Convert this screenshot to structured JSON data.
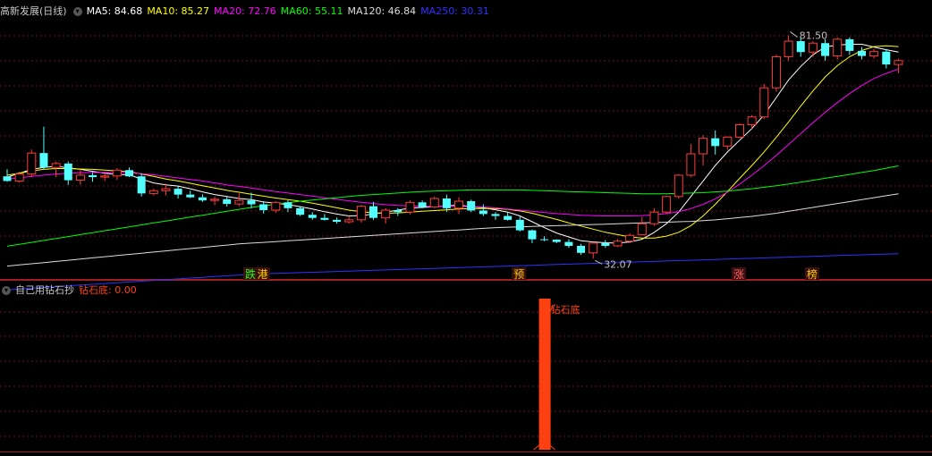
{
  "main_panel": {
    "title": "高新发展(日线)",
    "ma": [
      {
        "label": "MA5: 84.68",
        "color": "#ffffff"
      },
      {
        "label": "MA10: 85.27",
        "color": "#ffff00"
      },
      {
        "label": "MA20: 72.76",
        "color": "#ff00ff"
      },
      {
        "label": "MA60: 55.11",
        "color": "#00ff00"
      },
      {
        "label": "MA120: 46.84",
        "color": "#dcdcdc"
      },
      {
        "label": "MA250: 30.31",
        "color": "#3030ff"
      }
    ],
    "high_label": "81.50",
    "low_label": "32.07",
    "signals": [
      {
        "text": "跌",
        "color": "#20ff20",
        "bg": "#3a1010",
        "x_index": 20
      },
      {
        "text": "港",
        "color": "#ffcc00",
        "bg": "#3a1010",
        "x_index": 21
      },
      {
        "text": "预",
        "color": "#ffcc00",
        "bg": "#3a1010",
        "x_index": 42
      },
      {
        "text": "涨",
        "color": "#ff6060",
        "bg": "#3a1010",
        "x_index": 60
      },
      {
        "text": "榜",
        "color": "#ffcc00",
        "bg": "#3a1010",
        "x_index": 66
      }
    ]
  },
  "sub_panel": {
    "title": "自己用钻石抄",
    "value_label": "钻石底: 0.00",
    "annotation": "钻石底"
  },
  "colors": {
    "up": "#ff3c3c",
    "down": "#54ffff",
    "grid": "#6b1414",
    "bar": "#ff4010"
  },
  "chart_data": {
    "type": "candlestick",
    "ylim": [
      22,
      86
    ],
    "candles": [
      [
        45.2,
        47.0,
        43.8,
        44.0
      ],
      [
        44.0,
        46.4,
        43.6,
        45.8
      ],
      [
        45.8,
        52.1,
        45.0,
        51.2
      ],
      [
        51.2,
        58.0,
        47.0,
        47.5
      ],
      [
        47.5,
        49.0,
        45.0,
        48.5
      ],
      [
        48.5,
        49.0,
        43.0,
        44.2
      ],
      [
        44.2,
        47.0,
        43.0,
        45.5
      ],
      [
        45.5,
        46.3,
        43.8,
        45.0
      ],
      [
        45.0,
        46.0,
        44.0,
        45.3
      ],
      [
        45.3,
        47.3,
        44.3,
        46.8
      ],
      [
        46.8,
        47.5,
        45.0,
        45.2
      ],
      [
        45.2,
        46.0,
        40.0,
        40.8
      ],
      [
        40.8,
        42.0,
        40.3,
        41.5
      ],
      [
        41.5,
        43.3,
        40.3,
        42.0
      ],
      [
        42.0,
        42.6,
        39.5,
        40.5
      ],
      [
        40.5,
        41.5,
        39.6,
        39.8
      ],
      [
        39.8,
        40.6,
        38.6,
        39.0
      ],
      [
        39.0,
        40.0,
        37.8,
        39.3
      ],
      [
        39.3,
        40.0,
        37.4,
        38.1
      ],
      [
        38.1,
        40.8,
        37.5,
        39.0
      ],
      [
        39.0,
        41.0,
        37.0,
        38.0
      ],
      [
        38.0,
        38.8,
        35.6,
        36.5
      ],
      [
        36.5,
        38.8,
        35.8,
        38.5
      ],
      [
        38.5,
        39.0,
        36.0,
        37.0
      ],
      [
        37.0,
        37.4,
        35.0,
        35.3
      ],
      [
        35.3,
        36.0,
        34.0,
        34.5
      ],
      [
        34.5,
        35.5,
        33.8,
        34.0
      ],
      [
        34.0,
        34.6,
        33.0,
        33.5
      ],
      [
        33.5,
        35.0,
        33.0,
        34.0
      ],
      [
        34.0,
        37.8,
        33.3,
        37.5
      ],
      [
        37.5,
        38.6,
        34.0,
        34.5
      ],
      [
        34.5,
        37.0,
        33.0,
        36.5
      ],
      [
        36.5,
        37.0,
        35.0,
        36.0
      ],
      [
        36.0,
        39.0,
        35.4,
        38.5
      ],
      [
        38.5,
        39.0,
        37.0,
        37.3
      ],
      [
        37.3,
        40.0,
        37.0,
        39.5
      ],
      [
        39.5,
        40.5,
        36.0,
        37.0
      ],
      [
        37.0,
        39.8,
        35.5,
        38.8
      ],
      [
        38.8,
        39.2,
        36.0,
        36.4
      ],
      [
        36.4,
        38.0,
        35.0,
        35.5
      ],
      [
        35.5,
        36.0,
        34.0,
        35.0
      ],
      [
        35.0,
        36.0,
        33.8,
        34.0
      ],
      [
        34.0,
        34.8,
        31.0,
        31.3
      ],
      [
        31.3,
        31.5,
        28.0,
        29.0
      ],
      [
        29.0,
        29.8,
        28.5,
        28.9
      ],
      [
        28.9,
        29.0,
        28.0,
        28.3
      ],
      [
        28.3,
        29.0,
        26.8,
        27.3
      ],
      [
        27.3,
        27.8,
        25.0,
        25.5
      ],
      [
        25.5,
        28.2,
        24.0,
        28.0
      ],
      [
        28.0,
        28.8,
        26.8,
        27.3
      ],
      [
        27.3,
        29.0,
        27.0,
        28.5
      ],
      [
        28.5,
        30.5,
        28.0,
        30.0
      ],
      [
        30.2,
        34.7,
        30.0,
        33.0
      ],
      [
        33.0,
        37.0,
        32.5,
        36.0
      ],
      [
        36.0,
        40.2,
        35.5,
        40.0
      ],
      [
        40.0,
        45.7,
        39.5,
        45.5
      ],
      [
        45.5,
        53.5,
        45.0,
        51.0
      ],
      [
        51.0,
        55.8,
        48.0,
        55.0
      ],
      [
        55.0,
        57.0,
        50.8,
        53.0
      ],
      [
        53.0,
        55.5,
        52.0,
        55.3
      ],
      [
        55.3,
        58.8,
        55.0,
        58.5
      ],
      [
        58.5,
        61.0,
        57.5,
        60.5
      ],
      [
        60.5,
        69.0,
        60.0,
        68.0
      ],
      [
        68.0,
        76.5,
        67.0,
        76.0
      ],
      [
        76.0,
        81.5,
        75.0,
        80.0
      ],
      [
        80.0,
        81.0,
        76.0,
        77.2
      ],
      [
        77.2,
        80.0,
        76.0,
        79.5
      ],
      [
        79.5,
        80.5,
        75.0,
        76.2
      ],
      [
        76.2,
        81.0,
        75.3,
        80.5
      ],
      [
        80.5,
        81.0,
        76.5,
        77.5
      ],
      [
        77.5,
        78.5,
        75.3,
        76.2
      ],
      [
        76.2,
        78.0,
        75.5,
        77.3
      ],
      [
        77.3,
        78.0,
        73.0,
        74.0
      ],
      [
        74.0,
        75.5,
        71.8,
        75.0
      ]
    ],
    "ma_series": [
      {
        "name": "MA5",
        "color": "#ffffff",
        "values": [
          45,
          46,
          47,
          47.5,
          47.8,
          47.4,
          47,
          46.5,
          46,
          45.7,
          45.6,
          44.5,
          43.5,
          43,
          42.7,
          42,
          41.2,
          40.5,
          40,
          39.5,
          39.2,
          38.6,
          38.3,
          37.9,
          37.4,
          36.8,
          36.1,
          35.5,
          35,
          35.1,
          35.5,
          36,
          36.5,
          37,
          37.2,
          37.4,
          37.6,
          37.8,
          37.4,
          37.1,
          36.6,
          36,
          35,
          33.5,
          32,
          30.6,
          29.6,
          28.6,
          28.3,
          28.1,
          28,
          28.3,
          29,
          30.8,
          33,
          36,
          40,
          44,
          48,
          51.5,
          54.5,
          57.5,
          61,
          65.5,
          70,
          73.5,
          76.5,
          78.5,
          79,
          79.2,
          79.2,
          78.5,
          77.8,
          77.2
        ]
      },
      {
        "name": "MA10",
        "color": "#ffff00",
        "values": [
          45.5,
          46,
          46.6,
          47,
          47.2,
          47.2,
          47.1,
          47,
          46.8,
          46.6,
          46.4,
          45.8,
          45.2,
          44.5,
          44,
          43.4,
          42.8,
          42.2,
          41.6,
          41.1,
          40.6,
          40.1,
          39.6,
          39.2,
          38.8,
          38.3,
          37.7,
          37.1,
          36.5,
          36.1,
          35.8,
          35.7,
          35.8,
          36,
          36.2,
          36.4,
          36.6,
          36.8,
          36.9,
          36.9,
          36.9,
          36.7,
          36.3,
          35.7,
          34.9,
          34.1,
          33.2,
          32.4,
          31.6,
          30.8,
          30.2,
          29.6,
          29.3,
          29.3,
          29.8,
          30.8,
          32.5,
          35,
          38,
          41.3,
          44.7,
          48,
          51.5,
          55.3,
          59.2,
          63.3,
          67.2,
          70.8,
          73.7,
          76,
          77.6,
          78.6,
          78.8,
          78.6
        ]
      },
      {
        "name": "MA20",
        "color": "#ff00ff",
        "values": [
          44.5,
          44.8,
          45.2,
          45.5,
          45.8,
          46,
          46.1,
          46.2,
          46.2,
          46.2,
          46.1,
          45.9,
          45.6,
          45.2,
          44.8,
          44.4,
          44,
          43.5,
          43,
          42.6,
          42.2,
          41.7,
          41.3,
          40.9,
          40.5,
          40.1,
          39.7,
          39.3,
          38.9,
          38.5,
          38.2,
          37.9,
          37.7,
          37.6,
          37.5,
          37.5,
          37.5,
          37.5,
          37.4,
          37.3,
          37.1,
          36.8,
          36.5,
          36.2,
          35.9,
          35.6,
          35.4,
          35.2,
          35.1,
          35,
          35,
          35,
          35.1,
          35.3,
          35.6,
          36.1,
          36.9,
          38,
          39.4,
          41.1,
          43.2,
          45.5,
          48,
          50.6,
          53.4,
          56.2,
          59,
          61.7,
          64.2,
          66.5,
          68.6,
          70.4,
          71.7,
          72.8
        ]
      },
      {
        "name": "MA60",
        "color": "#00ff00",
        "values": [
          27.2,
          27.7,
          28.2,
          28.7,
          29.2,
          29.7,
          30.2,
          30.7,
          31.2,
          31.7,
          32.2,
          32.7,
          33.2,
          33.7,
          34.2,
          34.7,
          35.2,
          35.7,
          36.2,
          36.7,
          37.2,
          37.6,
          38,
          38.4,
          38.8,
          39.1,
          39.4,
          39.7,
          40,
          40.3,
          40.5,
          40.7,
          40.9,
          41.1,
          41.3,
          41.4,
          41.5,
          41.6,
          41.7,
          41.7,
          41.7,
          41.7,
          41.7,
          41.6,
          41.5,
          41.4,
          41.3,
          41.2,
          41.1,
          41,
          40.9,
          40.8,
          40.7,
          40.7,
          40.7,
          40.8,
          40.9,
          41,
          41.2,
          41.4,
          41.7,
          42,
          42.4,
          42.8,
          43.2,
          43.7,
          44.2,
          44.7,
          45.2,
          45.7,
          46.2,
          46.7,
          47.3,
          47.9
        ]
      },
      {
        "name": "MA120",
        "color": "#dcdcdc",
        "values": [
          22.1,
          22.4,
          22.7,
          23,
          23.3,
          23.6,
          23.9,
          24.2,
          24.5,
          24.8,
          25.1,
          25.4,
          25.7,
          26,
          26.3,
          26.6,
          26.9,
          27.2,
          27.5,
          27.8,
          28,
          28.2,
          28.4,
          28.6,
          28.8,
          29,
          29.2,
          29.4,
          29.6,
          29.8,
          30,
          30.2,
          30.4,
          30.6,
          30.8,
          31,
          31.2,
          31.4,
          31.6,
          31.8,
          32,
          32.1,
          32.2,
          32.3,
          32.4,
          32.5,
          32.6,
          32.7,
          32.8,
          32.9,
          33,
          33.1,
          33.2,
          33.3,
          33.4,
          33.5,
          33.6,
          33.8,
          34,
          34.3,
          34.6,
          34.9,
          35.3,
          35.7,
          36.2,
          36.7,
          37.2,
          37.7,
          38.2,
          38.7,
          39.2,
          39.7,
          40.2,
          40.7
        ]
      },
      {
        "name": "MA250",
        "color": "#3030ff",
        "values": [
          16,
          16.2,
          16.4,
          16.6,
          16.8,
          17,
          17.2,
          17.4,
          17.6,
          17.8,
          18,
          18.2,
          18.4,
          18.6,
          18.8,
          19,
          19.2,
          19.4,
          19.6,
          19.8,
          20,
          20.1,
          20.2,
          20.3,
          20.4,
          20.5,
          20.6,
          20.7,
          20.8,
          20.9,
          21,
          21.1,
          21.2,
          21.3,
          21.4,
          21.5,
          21.6,
          21.7,
          21.8,
          21.9,
          22,
          22.1,
          22.2,
          22.3,
          22.4,
          22.5,
          22.6,
          22.7,
          22.8,
          22.9,
          23,
          23.1,
          23.2,
          23.3,
          23.4,
          23.5,
          23.6,
          23.7,
          23.8,
          23.9,
          24,
          24.1,
          24.2,
          24.3,
          24.4,
          24.5,
          24.6,
          24.7,
          24.8,
          24.9,
          25,
          25.1,
          25.2,
          25.3
        ]
      }
    ],
    "indicator": {
      "name": "钻石底",
      "values_nonzero": [
        {
          "index": 44,
          "value": 1
        }
      ]
    }
  }
}
